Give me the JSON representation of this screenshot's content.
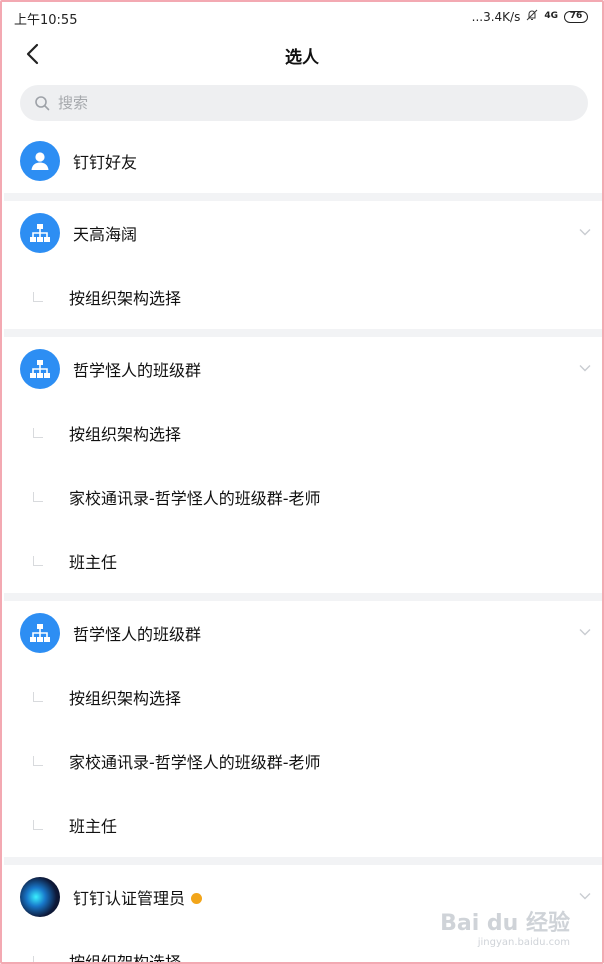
{
  "status_bar": {
    "time": "上午10:55",
    "network_speed": "...3.4K/s",
    "signal": "4G",
    "battery": "76"
  },
  "header": {
    "title": "选人"
  },
  "search": {
    "placeholder": "搜索"
  },
  "contacts": {
    "friends_label": "钉钉好友"
  },
  "groups": [
    {
      "name": "天高海阔",
      "icon": "org-chart-icon",
      "options": [
        "按组织架构选择"
      ]
    },
    {
      "name": "哲学怪人的班级群",
      "icon": "org-chart-icon",
      "options": [
        "按组织架构选择",
        "家校通讯录-哲学怪人的班级群-老师",
        "班主任"
      ]
    },
    {
      "name": "哲学怪人的班级群",
      "icon": "org-chart-icon",
      "options": [
        "按组织架构选择",
        "家校通讯录-哲学怪人的班级群-老师",
        "班主任"
      ]
    },
    {
      "name": "钉钉认证管理员",
      "icon": "admin-avatar-icon",
      "verified": true,
      "options": [
        "按组织架构选择"
      ]
    }
  ],
  "watermark": {
    "main": "Bai du 经验",
    "sub": "jingyan.baidu.com"
  },
  "colors": {
    "accent": "#2d8ef3",
    "divider": "#f2f3f5",
    "search_bg": "#eeeff1",
    "verified": "#f2a51a"
  }
}
